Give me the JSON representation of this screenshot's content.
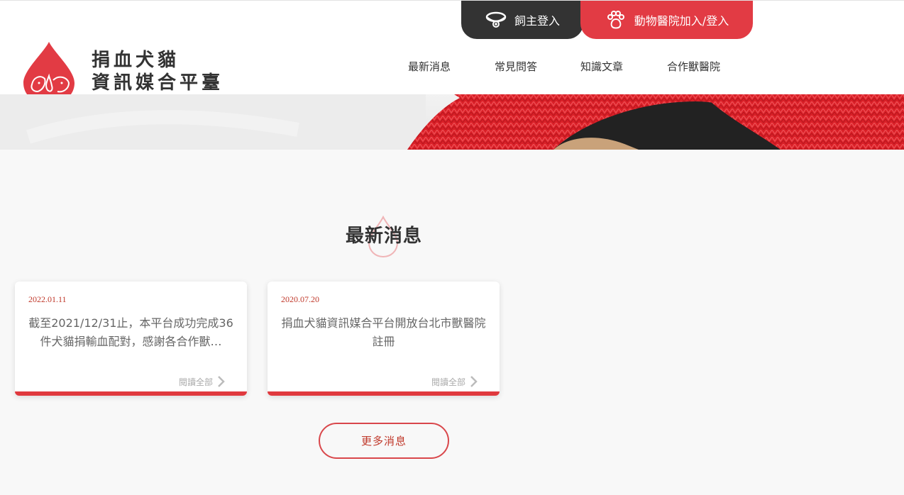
{
  "brand": {
    "line1": "捐血犬貓",
    "line2": "資訊媒合平臺"
  },
  "top_buttons": {
    "owner_login": "飼主登入",
    "hospital_login": "動物醫院加入/登入"
  },
  "nav": [
    "最新消息",
    "常見問答",
    "知識文章",
    "合作獸醫院"
  ],
  "section": {
    "title": "最新消息"
  },
  "news": [
    {
      "date": "2022.01.11",
      "text": "截至2021/12/31止，本平台成功完成36件犬貓捐輸血配對，感謝各合作獸…",
      "read_more": "閱讀全部"
    },
    {
      "date": "2020.07.20",
      "text": "捐血犬貓資訊媒合平台開放台北市獸醫院註冊",
      "read_more": "閱讀全部"
    }
  ],
  "more_news": "更多消息",
  "colors": {
    "accent": "#e23b44",
    "dark": "#333333",
    "bar": "#e0393e"
  },
  "icons": {
    "owner": "pet-collar-icon",
    "hospital": "paw-icon",
    "read_more": "chevron-right-icon"
  }
}
